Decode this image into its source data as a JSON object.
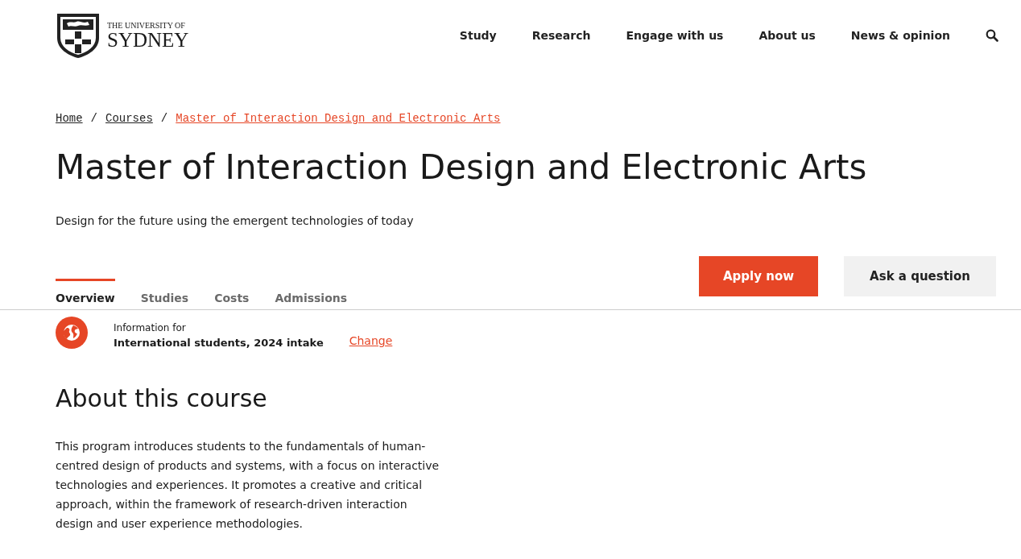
{
  "logo": {
    "line1": "THE UNIVERSITY OF",
    "line2": "SYDNEY"
  },
  "nav": [
    "Study",
    "Research",
    "Engage with us",
    "About us",
    "News & opinion"
  ],
  "breadcrumb": [
    {
      "label": "Home",
      "current": false
    },
    {
      "label": "Courses",
      "current": false
    },
    {
      "label": "Master of Interaction Design and Electronic Arts",
      "current": true
    }
  ],
  "breadcrumb_separator": "/",
  "title": "Master of Interaction Design and Electronic Arts",
  "subtitle": "Design for the future using the emergent technologies of today",
  "tabs": [
    {
      "label": "Overview",
      "selected": true
    },
    {
      "label": "Studies",
      "selected": false
    },
    {
      "label": "Costs",
      "selected": false
    },
    {
      "label": "Admissions",
      "selected": false
    }
  ],
  "buttons": [
    {
      "label": "Apply now",
      "kind": "primary"
    },
    {
      "label": "Ask a question",
      "kind": "secondary"
    }
  ],
  "audience": {
    "caption": "Information for",
    "value": "International students, 2024 intake",
    "link": "Change"
  },
  "about": {
    "heading": "About this course",
    "text": "This program introduces students to the fundamentals of human-centred design of products and systems, with a focus on interactive technologies and experiences. It promotes a creative and critical approach, within the framework of research-driven interaction design and user experience methodologies."
  }
}
